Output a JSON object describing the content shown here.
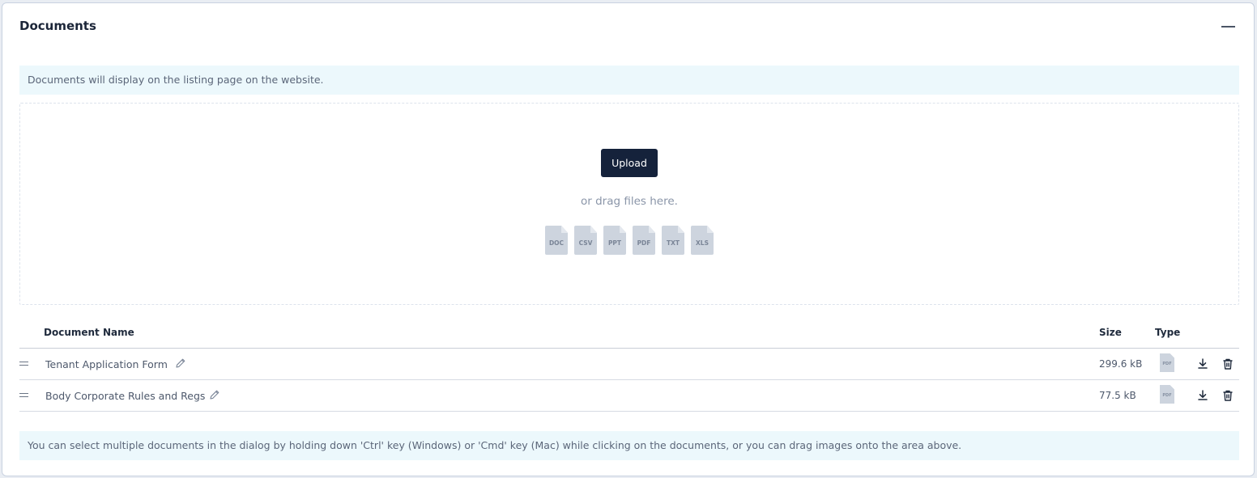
{
  "panel": {
    "title": "Documents",
    "info_top": "Documents will display on the listing page on the website.",
    "info_bottom": "You can select multiple documents in the dialog by holding down 'Ctrl' key (Windows) or 'Cmd' key (Mac) while clicking on the documents, or you can drag images onto the area above."
  },
  "dropzone": {
    "upload_label": "Upload",
    "drag_text": "or drag files here.",
    "file_types": [
      "DOC",
      "CSV",
      "PPT",
      "PDF",
      "TXT",
      "XLS"
    ]
  },
  "table": {
    "headers": {
      "name": "Document Name",
      "size": "Size",
      "type": "Type"
    },
    "rows": [
      {
        "name": "Tenant Application Form",
        "size": "299.6 kB",
        "type": "PDF"
      },
      {
        "name": "Body Corporate Rules and Regs",
        "size": "77.5 kB",
        "type": "PDF"
      }
    ]
  },
  "icons": [
    "minus-icon",
    "drag-handle-icon",
    "pencil-icon",
    "pdf-file-icon",
    "download-icon",
    "trash-icon"
  ],
  "colors": {
    "primary_button": "#15223b",
    "info_background": "#ecf8fc",
    "file_icon": "#cdd4de"
  }
}
